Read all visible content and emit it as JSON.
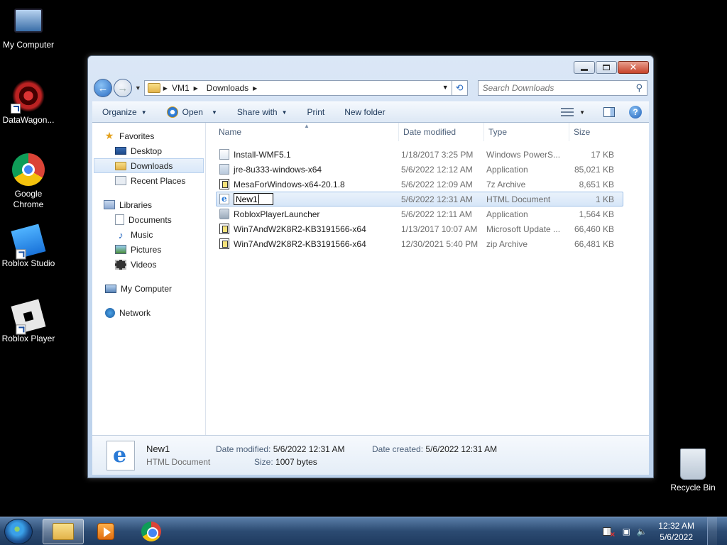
{
  "desktop": {
    "icons": [
      {
        "label": "My Computer"
      },
      {
        "label": "DataWagon..."
      },
      {
        "label": "Google Chrome"
      },
      {
        "label": "Roblox Studio"
      },
      {
        "label": "Roblox Player"
      },
      {
        "label": "Recycle Bin"
      }
    ]
  },
  "window": {
    "address": {
      "crumbs": [
        "VM1",
        "Downloads"
      ]
    },
    "search": {
      "placeholder": "Search Downloads"
    },
    "toolbar": {
      "organize": "Organize",
      "open": "Open",
      "share_with": "Share with",
      "print": "Print",
      "new_folder": "New folder"
    },
    "nav": {
      "favorites": "Favorites",
      "desktop": "Desktop",
      "downloads": "Downloads",
      "recent_places": "Recent Places",
      "libraries": "Libraries",
      "documents": "Documents",
      "music": "Music",
      "pictures": "Pictures",
      "videos": "Videos",
      "my_computer": "My Computer",
      "network": "Network"
    },
    "columns": {
      "name": "Name",
      "date_modified": "Date modified",
      "type": "Type",
      "size": "Size"
    },
    "files": [
      {
        "name": "Install-WMF5.1",
        "date": "1/18/2017 3:25 PM",
        "type": "Windows PowerS...",
        "size": "17 KB",
        "icon": "powershell-file-icon"
      },
      {
        "name": "jre-8u333-windows-x64",
        "date": "5/6/2022 12:12 AM",
        "type": "Application",
        "size": "85,021 KB",
        "icon": "java-app-icon"
      },
      {
        "name": "MesaForWindows-x64-20.1.8",
        "date": "5/6/2022 12:09 AM",
        "type": "7z Archive",
        "size": "8,651 KB",
        "icon": "archive-icon"
      },
      {
        "name": "New1",
        "date": "5/6/2022 12:31 AM",
        "type": "HTML Document",
        "size": "1 KB",
        "icon": "html-document-icon"
      },
      {
        "name": "RobloxPlayerLauncher",
        "date": "5/6/2022 12:11 AM",
        "type": "Application",
        "size": "1,564 KB",
        "icon": "application-icon"
      },
      {
        "name": "Win7AndW2K8R2-KB3191566-x64",
        "date": "1/13/2017 10:07 AM",
        "type": "Microsoft Update ...",
        "size": "66,460 KB",
        "icon": "update-package-icon"
      },
      {
        "name": "Win7AndW2K8R2-KB3191566-x64",
        "date": "12/30/2021 5:40 PM",
        "type": "zip Archive",
        "size": "66,481 KB",
        "icon": "zip-archive-icon"
      }
    ],
    "rename_value": "New1",
    "details": {
      "name": "New1",
      "type": "HTML Document",
      "date_modified_label": "Date modified:",
      "date_modified": "5/6/2022 12:31 AM",
      "date_created_label": "Date created:",
      "date_created": "5/6/2022 12:31 AM",
      "size_label": "Size:",
      "size": "1007 bytes"
    }
  },
  "taskbar": {
    "time": "12:32 AM",
    "date": "5/6/2022"
  }
}
